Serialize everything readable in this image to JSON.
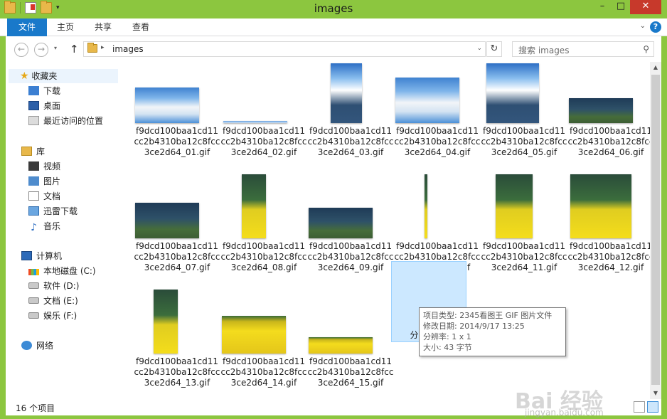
{
  "window": {
    "title": "images"
  },
  "ribbon": {
    "tabs": [
      "文件",
      "主页",
      "共享",
      "查看"
    ]
  },
  "nav": {
    "path": "images",
    "search_placeholder": "搜索 images"
  },
  "sidebar": {
    "favorites": {
      "label": "收藏夹",
      "items": [
        "下载",
        "桌面",
        "最近访问的位置"
      ]
    },
    "libraries": {
      "label": "库",
      "items": [
        "视频",
        "图片",
        "文档",
        "迅雷下载",
        "音乐"
      ]
    },
    "computer": {
      "label": "计算机",
      "items": [
        "本地磁盘 (C:)",
        "软件 (D:)",
        "文档 (E:)",
        "娱乐 (F:)"
      ]
    },
    "network": {
      "label": "网络"
    }
  },
  "files": [
    {
      "name": "f9dcd100baa1cd11cc2b4310ba12c8fcc3ce2d64_01.gif"
    },
    {
      "name": "f9dcd100baa1cd11cc2b4310ba12c8fcc3ce2d64_02.gif"
    },
    {
      "name": "f9dcd100baa1cd11cc2b4310ba12c8fcc3ce2d64_03.gif"
    },
    {
      "name": "f9dcd100baa1cd11cc2b4310ba12c8fcc3ce2d64_04.gif"
    },
    {
      "name": "f9dcd100baa1cd11cc2b4310ba12c8fcc3ce2d64_05.gif"
    },
    {
      "name": "f9dcd100baa1cd11cc2b4310ba12c8fcc3ce2d64_06.gif"
    },
    {
      "name": "f9dcd100baa1cd11cc2b4310ba12c8fcc3ce2d64_07.gif"
    },
    {
      "name": "f9dcd100baa1cd11cc2b4310ba12c8fcc3ce2d64_08.gif"
    },
    {
      "name": "f9dcd100baa1cd11cc2b4310ba12c8fcc3ce2d64_09.gif"
    },
    {
      "name": "f9dcd100baa1cd11cc2b4310ba12c8fcc3ce2d64_10.gif"
    },
    {
      "name": "f9dcd100baa1cd11cc2b4310ba12c8fcc3ce2d64_11.gif"
    },
    {
      "name": "f9dcd100baa1cd11cc2b4310ba12c8fcc3ce2d64_12.gif"
    },
    {
      "name": "f9dcd100baa1cd11cc2b4310ba12c8fcc3ce2d64_13.gif"
    },
    {
      "name": "f9dcd100baa1cd11cc2b4310ba12c8fcc3ce2d64_14.gif"
    },
    {
      "name": "f9dcd100baa1cd11cc2b4310ba12c8fcc3ce2d64_15.gif"
    }
  ],
  "selected_file": {
    "name": "分隔符.gif"
  },
  "tooltip": {
    "type": "项目类型: 2345看图王 GIF 图片文件",
    "modified": "修改日期: 2014/9/17 13:25",
    "resolution": "分辨率: 1 x 1",
    "size": "大小: 43 字节"
  },
  "status": {
    "count": "16 个项目"
  },
  "watermark": {
    "text": "Bai 经验",
    "sub": "jingyan.baidu.com"
  },
  "colors": {
    "titlebar": "#8cc63f",
    "file_tab": "#1979ca",
    "close": "#c7392b",
    "selection": "#cce8ff"
  }
}
